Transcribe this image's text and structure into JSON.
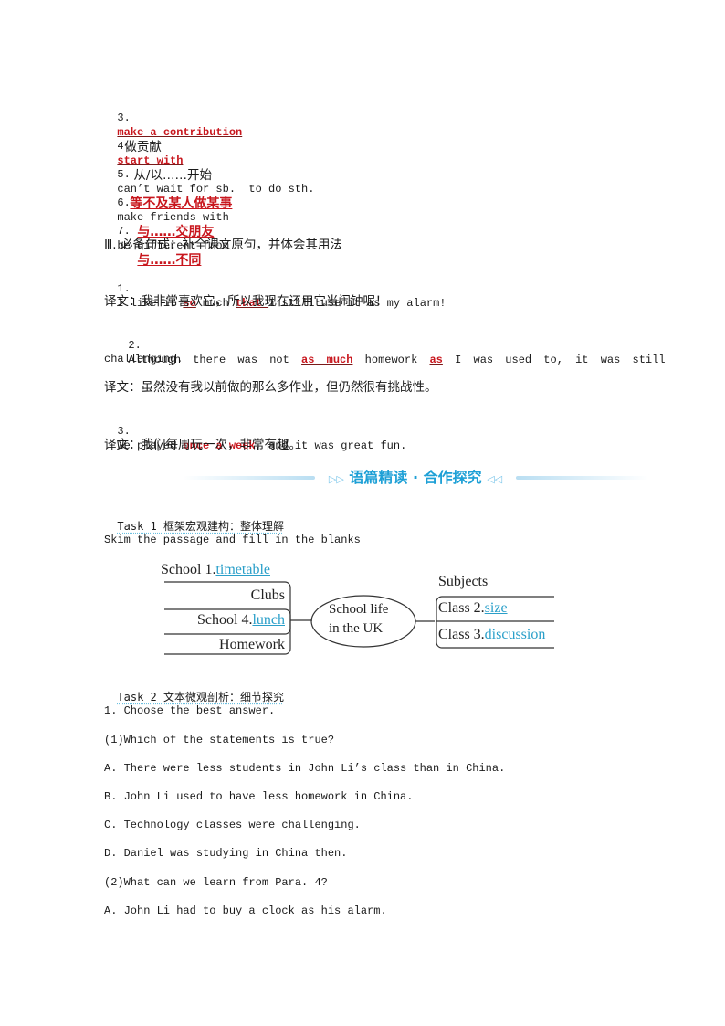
{
  "phrases": [
    {
      "num": "3.",
      "answer": "make a contribution",
      "meaning": "做贡献"
    },
    {
      "num": "4.",
      "answer": "start with",
      "meaning": "从/以……开始"
    },
    {
      "num": "5.",
      "phrase": "can’t wait for sb.  to do sth.",
      "answer_cn": "等不及某人做某事"
    },
    {
      "num": "6.",
      "phrase": "make friends with",
      "answer_cn": "与……交朋友"
    },
    {
      "num": "7.",
      "phrase": "be different from",
      "answer_cn": "与……不同"
    }
  ],
  "section3": {
    "heading": "Ⅲ. 必备句式：补全课文原句，并体会其用法",
    "sentences": [
      {
        "num": "1.",
        "pre": "I like it ",
        "ans1": "so",
        "mid": " much ",
        "ans2": "that ",
        "post": "I still use it as my alarm!",
        "translation": "译文：我非常喜欢它，所以我现在还用它当闹钟呢！"
      },
      {
        "num": "2.",
        "pre": "Although there was not ",
        "ans1": "as much",
        "mid": " homework ",
        "ans2": "as",
        "post": " I was used to, it was still",
        "cont": "challenging.",
        "translation": "译文：虽然没有我以前做的那么多作业，但仍然很有挑战性。"
      },
      {
        "num": "3.",
        "pre": "We played ",
        "ans1": "once a week",
        "post": ", and it was great fun.",
        "translation": "译文：我们每周玩一次，非常有趣。"
      }
    ]
  },
  "banner": {
    "title": "语篇精读 · 合作探究",
    "left_arrow": "▷▷",
    "right_arrow": "◁◁",
    "color": "#1ea0d6"
  },
  "task1": {
    "heading": "Task 1 框架宏观建构：整体理解",
    "instruction": "Skim the passage and fill in the blanks",
    "mindmap": {
      "center": [
        "School life",
        "in the UK"
      ],
      "left": [
        {
          "prefix": "School 1.",
          "answer": "timetable"
        },
        {
          "label": "Clubs"
        },
        {
          "prefix": "School 4.",
          "answer": "lunch"
        },
        {
          "label": "Homework"
        }
      ],
      "right_title": "Subjects",
      "right": [
        {
          "prefix": "Class 2.",
          "answer": "size"
        },
        {
          "prefix": "Class 3.",
          "answer": "discussion"
        }
      ]
    }
  },
  "task2": {
    "heading": "Task 2 文本微观剖析：细节探究",
    "instruction": "1. Choose the best answer.",
    "questions": [
      {
        "q": "(1)Which of the statements is true?",
        "options": [
          "A. There were less students in John Li’s class than in China.",
          "B. John Li used to have less homework in China.",
          "C. Technology classes were challenging.",
          "D. Daniel was studying in China then."
        ]
      },
      {
        "q": "(2)What can we learn from Para. 4?",
        "options": [
          "A. John Li had to buy a clock as his alarm."
        ]
      }
    ]
  }
}
